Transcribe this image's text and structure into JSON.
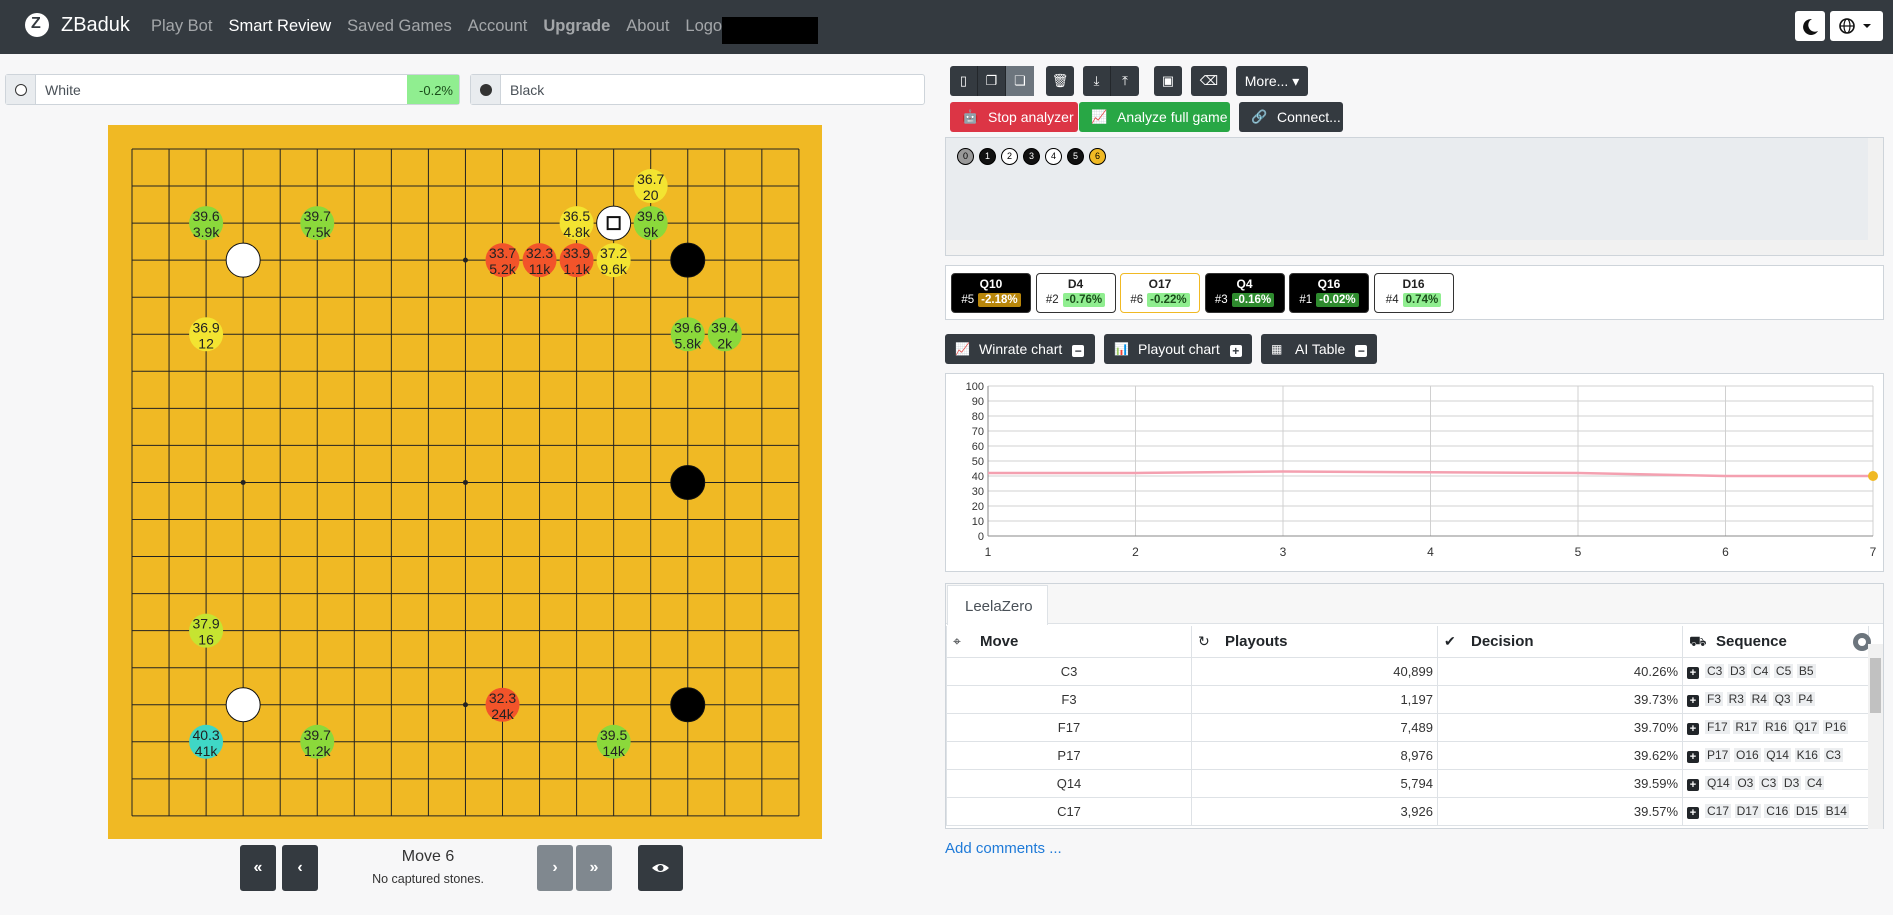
{
  "nav": {
    "brand": "ZBaduk",
    "items": [
      {
        "label": "Play Bot",
        "active": false
      },
      {
        "label": "Smart Review",
        "active": true
      },
      {
        "label": "Saved Games",
        "active": false
      },
      {
        "label": "Account",
        "active": false
      },
      {
        "label": "Upgrade",
        "active": false
      },
      {
        "label": "About",
        "active": false
      },
      {
        "label": "Logout",
        "active": false
      }
    ],
    "right_icons": [
      "moon-icon",
      "globe-icon"
    ]
  },
  "players": {
    "white": {
      "name": "White",
      "winrate_delta": "-0.2%"
    },
    "black": {
      "name": "Black"
    }
  },
  "board": {
    "size": 19,
    "star_points": [
      "D4",
      "D10",
      "D16",
      "K4",
      "K10",
      "K16",
      "Q4",
      "Q10",
      "Q16"
    ],
    "stones": [
      {
        "color": "white",
        "pos": "D16"
      },
      {
        "color": "white",
        "pos": "D4"
      },
      {
        "color": "white",
        "pos": "O17",
        "last_move": true
      },
      {
        "color": "black",
        "pos": "Q16"
      },
      {
        "color": "black",
        "pos": "Q10"
      },
      {
        "color": "black",
        "pos": "Q4"
      }
    ],
    "suggestions": [
      {
        "pos": "C17",
        "wr": "39.6",
        "po": "3.9k",
        "color": "#8bd93b"
      },
      {
        "pos": "F17",
        "wr": "39.7",
        "po": "7.5k",
        "color": "#8bd93b"
      },
      {
        "pos": "L16",
        "wr": "33.7",
        "po": "5.2k",
        "color": "#f2542a"
      },
      {
        "pos": "M16",
        "wr": "32.3",
        "po": "11k",
        "color": "#f2542a"
      },
      {
        "pos": "N16",
        "wr": "33.9",
        "po": "1.1k",
        "color": "#f2542a"
      },
      {
        "pos": "N17",
        "wr": "36.5",
        "po": "4.8k",
        "color": "#f3e431"
      },
      {
        "pos": "P18",
        "wr": "36.7",
        "po": "20",
        "color": "#f3e431"
      },
      {
        "pos": "P17",
        "wr": "39.6",
        "po": "9k",
        "color": "#8bd93b"
      },
      {
        "pos": "O16",
        "wr": "37.2",
        "po": "9.6k",
        "color": "#f3e431"
      },
      {
        "pos": "C14",
        "wr": "36.9",
        "po": "12",
        "color": "#f3e431"
      },
      {
        "pos": "Q14",
        "wr": "39.6",
        "po": "5.8k",
        "color": "#8bd93b"
      },
      {
        "pos": "R14",
        "wr": "39.4",
        "po": "2k",
        "color": "#8bd93b"
      },
      {
        "pos": "C6",
        "wr": "37.9",
        "po": "16",
        "color": "#c6e431"
      },
      {
        "pos": "L4",
        "wr": "32.3",
        "po": "24k",
        "color": "#f2542a"
      },
      {
        "pos": "C3",
        "wr": "40.3",
        "po": "41k",
        "color": "#3fd7c6"
      },
      {
        "pos": "F3",
        "wr": "39.7",
        "po": "1.2k",
        "color": "#8bd93b"
      },
      {
        "pos": "O3",
        "wr": "39.5",
        "po": "14k",
        "color": "#8bd93b"
      }
    ]
  },
  "controls": {
    "move_label": "Move 6",
    "captured": "No captured stones."
  },
  "toolbar": {
    "more_label": "More...",
    "stop_label": "Stop analyzer",
    "analyze_label": "Analyze full game",
    "connect_label": "Connect..."
  },
  "tree": {
    "nodes": [
      "0",
      "1",
      "2",
      "3",
      "4",
      "5",
      "6"
    ]
  },
  "history_cards": [
    {
      "move": "Q10",
      "rank": "#5",
      "delta": "-2.18%",
      "stone": "black",
      "pct_bg": "#b8860b",
      "pct_fg": "#fff"
    },
    {
      "move": "D4",
      "rank": "#2",
      "delta": "-0.76%",
      "stone": "white",
      "pct_bg": "#90ee90",
      "pct_fg": "#1a4d1a"
    },
    {
      "move": "O17",
      "rank": "#6",
      "delta": "-0.22%",
      "stone": "white",
      "pct_bg": "#90ee90",
      "pct_fg": "#1a4d1a",
      "highlight": true
    },
    {
      "move": "Q4",
      "rank": "#3",
      "delta": "-0.16%",
      "stone": "black",
      "pct_bg": "#2e8b2e",
      "pct_fg": "#fff"
    },
    {
      "move": "Q16",
      "rank": "#1",
      "delta": "-0.02%",
      "stone": "black",
      "pct_bg": "#2e8b2e",
      "pct_fg": "#fff"
    },
    {
      "move": "D16",
      "rank": "#4",
      "delta": "0.74%",
      "stone": "white",
      "pct_bg": "#90ee90",
      "pct_fg": "#1a4d1a"
    }
  ],
  "chart_buttons": {
    "winrate": "Winrate chart",
    "playout": "Playout chart",
    "ai_table": "AI Table"
  },
  "chart_data": {
    "type": "line",
    "x": [
      1,
      2,
      3,
      4,
      5,
      6,
      7
    ],
    "series": [
      {
        "values": [
          42,
          42,
          43,
          42.5,
          42,
          40,
          40
        ]
      }
    ],
    "ylim": [
      0,
      100
    ],
    "yticks": [
      0,
      10,
      20,
      30,
      40,
      50,
      60,
      70,
      80,
      90,
      100
    ],
    "xticks": [
      1,
      2,
      3,
      4,
      5,
      6,
      7
    ],
    "grid": true,
    "line_color": "#f4a0b0",
    "marker_color": "#f0b924"
  },
  "table": {
    "tab": "LeelaZero",
    "headers": [
      "Move",
      "Playouts",
      "Decision",
      "Sequence"
    ],
    "rows": [
      {
        "move": "C3",
        "playouts": "40,899",
        "decision": "40.26%",
        "seq": [
          "C3",
          "D3",
          "C4",
          "C5",
          "B5"
        ]
      },
      {
        "move": "F3",
        "playouts": "1,197",
        "decision": "39.73%",
        "seq": [
          "F3",
          "R3",
          "R4",
          "Q3",
          "P4"
        ]
      },
      {
        "move": "F17",
        "playouts": "7,489",
        "decision": "39.70%",
        "seq": [
          "F17",
          "R17",
          "R16",
          "Q17",
          "P16"
        ]
      },
      {
        "move": "P17",
        "playouts": "8,976",
        "decision": "39.62%",
        "seq": [
          "P17",
          "O16",
          "Q14",
          "K16",
          "C3"
        ]
      },
      {
        "move": "Q14",
        "playouts": "5,794",
        "decision": "39.59%",
        "seq": [
          "Q14",
          "O3",
          "C3",
          "D3",
          "C4"
        ]
      },
      {
        "move": "C17",
        "playouts": "3,926",
        "decision": "39.57%",
        "seq": [
          "C17",
          "D17",
          "C16",
          "D15",
          "B14"
        ]
      }
    ]
  },
  "add_comments": "Add comments ..."
}
